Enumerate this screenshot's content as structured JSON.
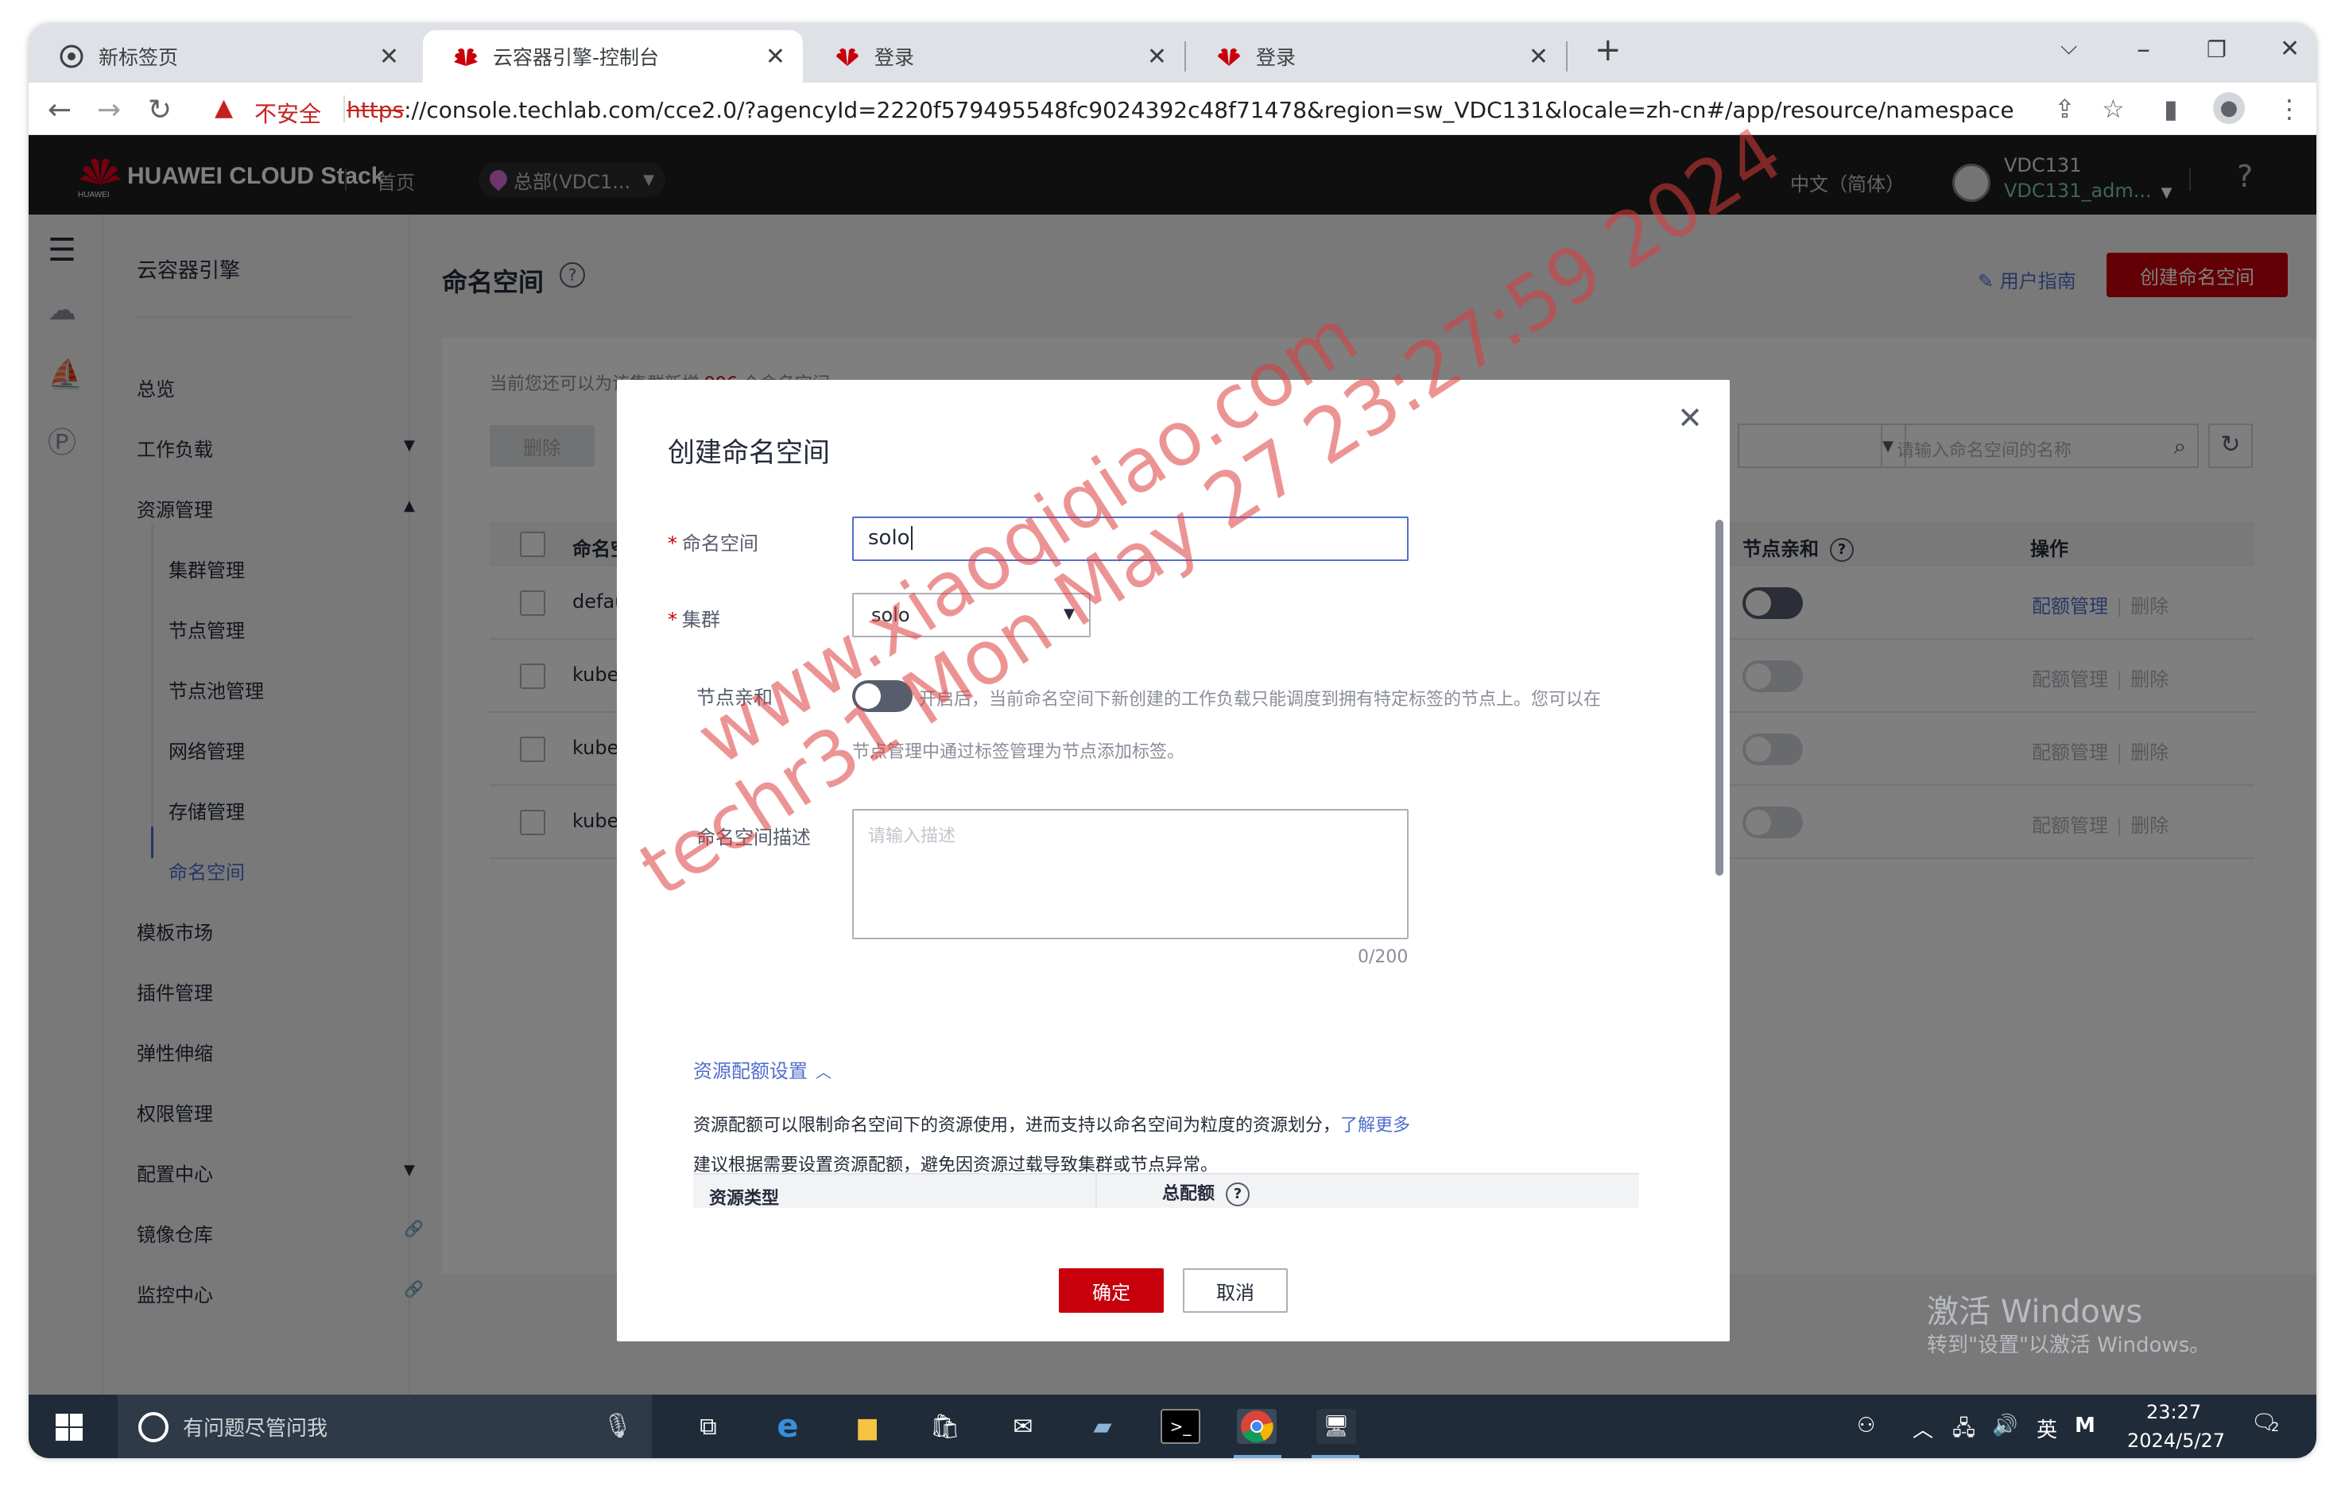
{
  "browser": {
    "tabs": [
      {
        "label": "新标签页"
      },
      {
        "label": "云容器引擎-控制台"
      },
      {
        "label": "登录"
      },
      {
        "label": "登录"
      }
    ],
    "security_label": "不安全",
    "url_scheme": "https",
    "url_rest": "://console.techlab.com/cce2.0/?agencyId=2220f579495548fc9024392c48f71478&region=sw_VDC131&locale=zh-cn#/app/resource/namespace"
  },
  "header": {
    "brand": "HUAWEI CLOUD Stack",
    "logo_caption": "HUAWEI",
    "home": "首页",
    "region": "总部(VDC1...",
    "language": "中文（简体）",
    "account_line1": "VDC131",
    "account_line2": "VDC131_adm...",
    "help": "?"
  },
  "sidebar": {
    "title": "云容器引擎",
    "items": [
      {
        "label": "总览"
      },
      {
        "label": "工作负载"
      },
      {
        "label": "资源管理"
      },
      {
        "label": "集群管理"
      },
      {
        "label": "节点管理"
      },
      {
        "label": "节点池管理"
      },
      {
        "label": "网络管理"
      },
      {
        "label": "存储管理"
      },
      {
        "label": "命名空间"
      },
      {
        "label": "模板市场"
      },
      {
        "label": "插件管理"
      },
      {
        "label": "弹性伸缩"
      },
      {
        "label": "权限管理"
      },
      {
        "label": "配置中心"
      },
      {
        "label": "镜像仓库"
      },
      {
        "label": "监控中心"
      }
    ]
  },
  "page": {
    "title": "命名空间",
    "user_guide": "用户指南",
    "create_button": "创建命名空间",
    "note_prefix": "当前您还可以为该集群新增",
    "note_count": "996",
    "note_suffix": "个命名空间",
    "delete_button": "删除",
    "search_placeholder": "请输入命名空间的名称",
    "columns": {
      "name": "命名空",
      "affinity": "节点亲和",
      "actions": "操作"
    },
    "rows": [
      {
        "name": "defau",
        "affinity_on": true
      },
      {
        "name": "kube-",
        "affinity_on": false
      },
      {
        "name": "kube-",
        "affinity_on": false
      },
      {
        "name": "kube-",
        "affinity_on": false
      }
    ],
    "op_quota": "配额管理",
    "op_delete": "删除"
  },
  "dialog": {
    "title": "创建命名空间",
    "name_label": "命名空间",
    "name_value": "solo",
    "cluster_label": "集群",
    "cluster_value": "solo",
    "affinity_label": "节点亲和",
    "affinity_tip_line1": "开启后，当前命名空间下新创建的工作负载只能调度到拥有特定标签的节点上。您可以在",
    "affinity_tip_line2": "节点管理中通过标签管理为节点添加标签。",
    "desc_label": "命名空间描述",
    "desc_placeholder": "请输入描述",
    "desc_count": "0/200",
    "quota_toggle": "资源配额设置",
    "quota_text1": "资源配额可以限制命名空间下的资源使用，进而支持以命名空间为粒度的资源划分，",
    "quota_link": "了解更多",
    "quota_text2": "建议根据需要设置资源配额，避免因资源过载导致集群或节点异常。",
    "quota_col_type": "资源类型",
    "quota_col_total": "总配额",
    "confirm": "确定",
    "cancel": "取消"
  },
  "watermark": {
    "line1": "www.xiaoqiqiao.com",
    "line2": "techr31 Mon May 27 23:27:59 2024"
  },
  "activation": {
    "line1": "激活 Windows",
    "line2": "转到\"设置\"以激活 Windows。"
  },
  "taskbar": {
    "search_placeholder": "有问题尽管问我",
    "ime": "英",
    "time": "23:27",
    "date": "2024/5/27",
    "notifications": "2"
  },
  "colors": {
    "brand_red": "#c7000b",
    "link_blue": "#526ecc",
    "header_bg": "#1f1f1f"
  }
}
